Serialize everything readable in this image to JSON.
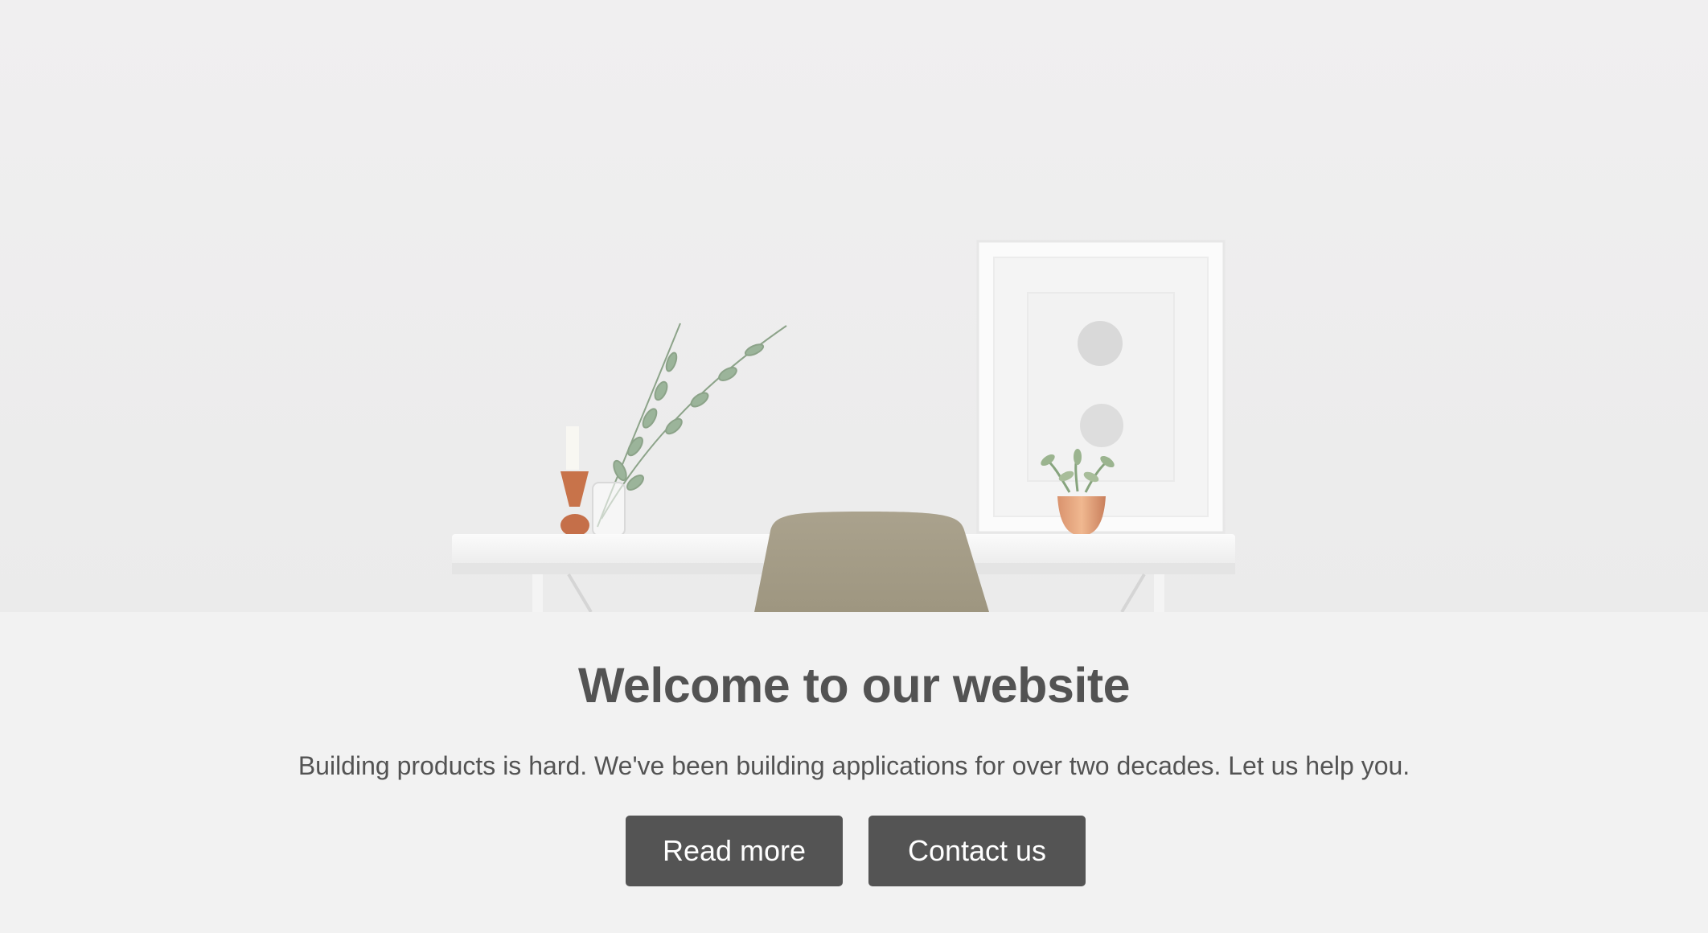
{
  "hero": {
    "image_description_icon": "desk-scene-image"
  },
  "main": {
    "headline": "Welcome to our website",
    "tagline": "Building products is hard. We've been building applications for over two decades. Let us help you."
  },
  "actions": {
    "read_more_label": "Read more",
    "contact_label": "Contact us"
  },
  "colors": {
    "background": "#f2f2f2",
    "text": "#535353",
    "button": "#545454",
    "button_text": "#ffffff"
  }
}
